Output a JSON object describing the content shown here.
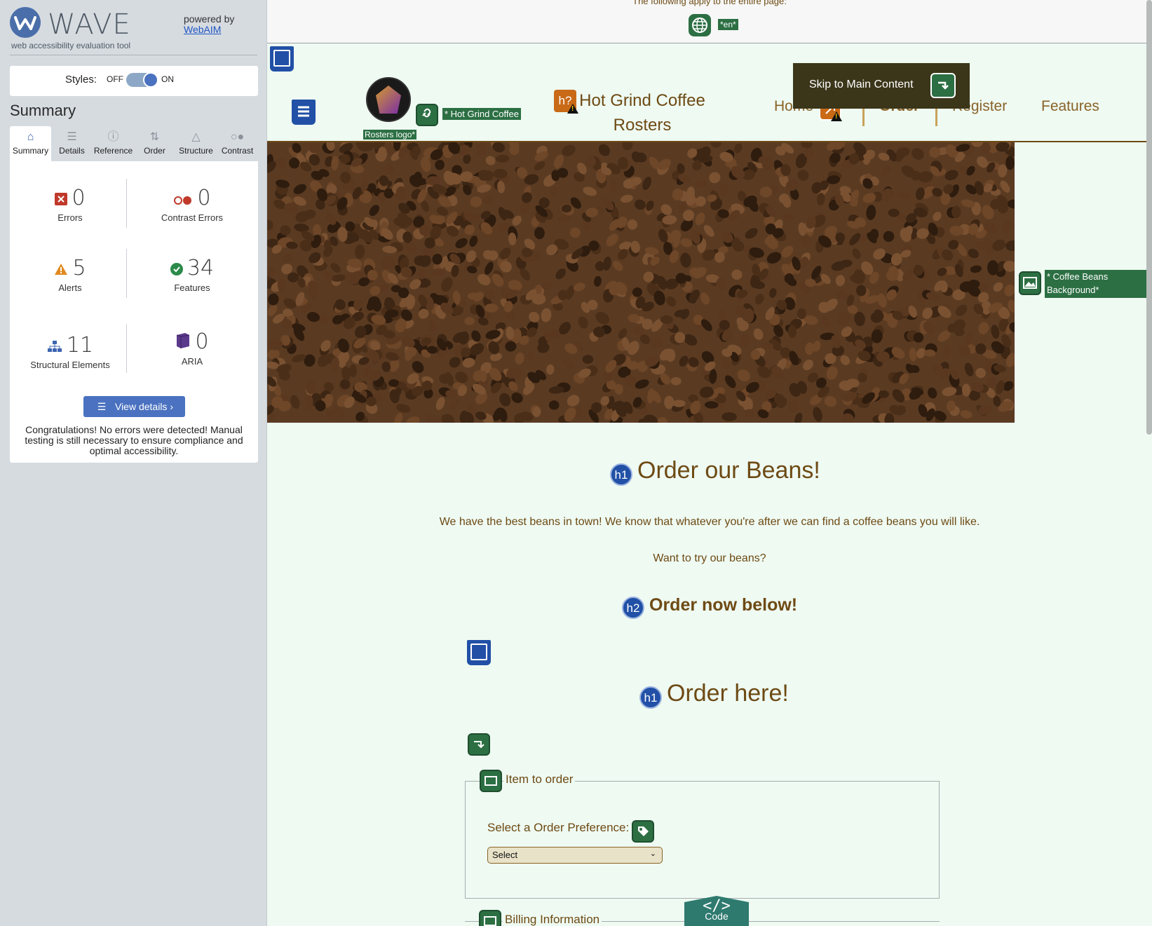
{
  "wave": {
    "logo_text": "WAVE",
    "tagline": "web accessibility evaluation tool",
    "powered_by": "powered by",
    "webaim_link": "WebAIM",
    "styles_label": "Styles:",
    "styles_off": "OFF",
    "styles_on": "ON",
    "summary_title": "Summary",
    "tabs": [
      {
        "label": "Summary",
        "icon": "home-icon"
      },
      {
        "label": "Details",
        "icon": "list-icon"
      },
      {
        "label": "Reference",
        "icon": "info-icon"
      },
      {
        "label": "Order",
        "icon": "order-icon"
      },
      {
        "label": "Structure",
        "icon": "structure-icon"
      },
      {
        "label": "Contrast",
        "icon": "contrast-icon"
      }
    ],
    "stats": {
      "errors": {
        "value": "0",
        "label": "Errors",
        "color": "#c0392b"
      },
      "contrast_errors": {
        "value": "0",
        "label": "Contrast Errors",
        "color": "#c0392b"
      },
      "alerts": {
        "value": "5",
        "label": "Alerts",
        "color": "#e08a1e"
      },
      "features": {
        "value": "34",
        "label": "Features",
        "color": "#2c8a4a"
      },
      "structural": {
        "value": "11",
        "label": "Structural Elements",
        "color": "#3d64b0"
      },
      "aria": {
        "value": "0",
        "label": "ARIA",
        "color": "#5b3a8c"
      }
    },
    "view_details": "View details ›",
    "congrats": "Congratulations! No errors were detected! Manual testing is still necessary to ensure compliance and optimal accessibility."
  },
  "page": {
    "top_notice": "The following apply to the entire page:",
    "lang_tag": "*en*",
    "logo_alt_label": "* Hot Grind Coffee",
    "logo_alt_label2": "Rosters logo*",
    "h2_badge": "h?",
    "site_title": "Hot Grind Coffee Rosters",
    "skip_link": "Skip to Main Content",
    "nav": [
      "Home",
      "Order",
      "Register",
      "Features"
    ],
    "bg_label": "* Coffee Beans Background*",
    "h1_main": "Order our Beans!",
    "h1_badge": "h1",
    "intro": "We have the best beans in town! We know that whatever you're after we can find a coffee beans you will like.",
    "try_text": "Want to try our beans?",
    "h2_badge2": "h2",
    "h2_text": "Order now below!",
    "h1_form": "Order here!",
    "legend_item": "Item to order",
    "select_label": "Select a Order Preference:",
    "select_value": "Select",
    "legend_billing": "Billing Information",
    "code_glyph": "</>",
    "code_label": "Code"
  },
  "colors": {
    "panel_bg": "#d6dbe0",
    "page_bg": "#eefaf2",
    "brown_text": "#6e4a14",
    "wave_blue": "#4a72c0",
    "feature_green": "#2c6f43"
  }
}
